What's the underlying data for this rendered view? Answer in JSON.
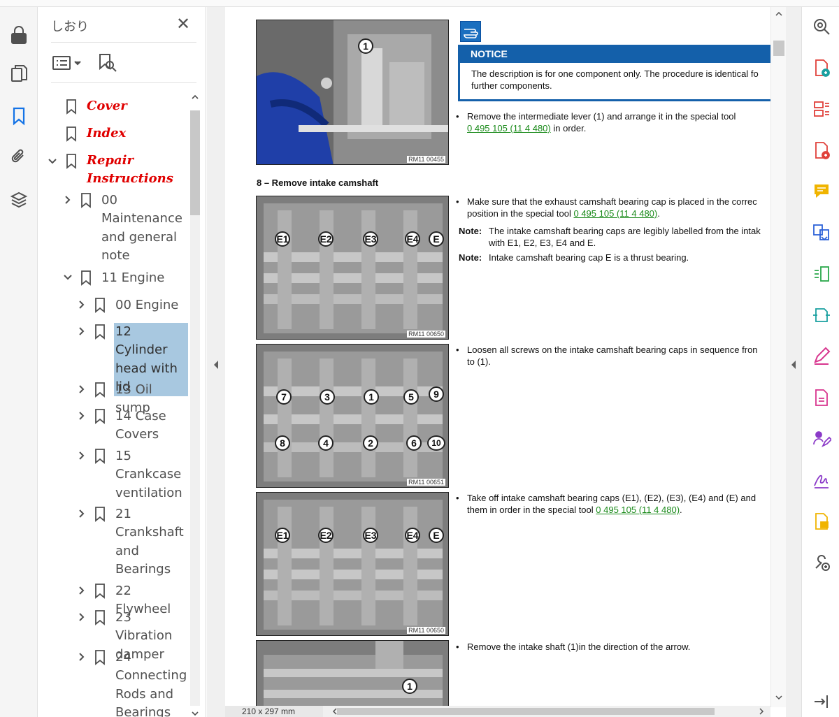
{
  "bookmarks_panel": {
    "title": "しおり",
    "close_symbol": "✕",
    "options_icon": "list-options-icon",
    "find_icon": "find-bookmark-icon",
    "items": [
      {
        "label": "Cover",
        "style": "red"
      },
      {
        "label": "Index",
        "style": "red"
      },
      {
        "label_lines": [
          "Repair",
          "Instructions"
        ],
        "style": "red"
      },
      {
        "label_lines": [
          "00",
          "Maintenance",
          "and general",
          "note"
        ]
      },
      {
        "label": "11 Engine"
      },
      {
        "label": "00 Engine"
      },
      {
        "label_lines": [
          "12 Cylinder",
          "head with",
          "lid"
        ],
        "selected": true
      },
      {
        "label": "13 Oil sump"
      },
      {
        "label_lines": [
          "14 Case",
          "Covers"
        ]
      },
      {
        "label_lines": [
          "15",
          "Crankcase",
          "ventilation"
        ]
      },
      {
        "label_lines": [
          "21",
          "Crankshaft",
          "and",
          "Bearings"
        ]
      },
      {
        "label": "22 Flywheel"
      },
      {
        "label_lines": [
          "23 Vibration",
          "damper"
        ]
      },
      {
        "label_lines": [
          "24",
          "Connecting",
          "Rods and",
          "Bearings"
        ]
      }
    ]
  },
  "document": {
    "notice_title": "NOTICE",
    "notice_line1": "The description is for one component only. The procedure is identical fo",
    "notice_line2": "further components.",
    "step1_line1": "Remove the intermediate lever (1) and arrange it in the special tool",
    "step1_link": "0 495 105 (11 4 480)",
    "step1_tail": " in order.",
    "section_heading": "8 – Remove intake camshaft",
    "step2_line1": "Make sure that the exhaust camshaft bearing cap is placed in the correc",
    "step2_line2_pre": "position in the special tool ",
    "step2_link": "0 495 105 (11 4 480)",
    "step2_tail": ".",
    "note_label": "Note:",
    "note1_line1": "The intake camshaft bearing caps are legibly labelled from the intak",
    "note1_line2": "with E1, E2, E3, E4 and E.",
    "note2": "Intake camshaft bearing cap E is a thrust bearing.",
    "step3_line1": "Loosen all screws on the intake camshaft bearing caps in sequence fron",
    "step3_line2": "to (1).",
    "step4_line1": "Take off intake camshaft bearing caps (E1), (E2), (E3), (E4) and (E) and",
    "step4_line2_pre": "them in order in the special tool ",
    "step4_link": "0 495 105 (11 4 480)",
    "step4_tail": ".",
    "step5_line1": "Remove the intake shaft (1)in the direction of the arrow.",
    "bullet": "•",
    "images": [
      {
        "code": "RM11 00455",
        "callouts": [
          "1"
        ]
      },
      {
        "code": "RM11 00650",
        "callouts": [
          "E1",
          "E2",
          "E3",
          "E4",
          "E"
        ]
      },
      {
        "code": "RM11 00651",
        "callouts": [
          "7",
          "3",
          "1",
          "5",
          "9",
          "8",
          "4",
          "2",
          "6",
          "10"
        ]
      },
      {
        "code": "RM11 00650",
        "callouts": [
          "E1",
          "E2",
          "E3",
          "E4",
          "E"
        ]
      },
      {
        "code": "",
        "callouts": [
          "1"
        ]
      }
    ]
  },
  "status": {
    "page_size": "210 x 297 mm"
  },
  "colors": {
    "accent": "#1473e6",
    "bookmark_red": "#e00000",
    "link_green": "#1a8a1a",
    "notice_blue": "#1460aa",
    "selection": "#a8c8e0"
  },
  "left_rail_icons": [
    "lock-icon",
    "pages-icon",
    "bookmark-icon",
    "attachment-icon",
    "layers-icon"
  ],
  "right_rail_icons": [
    "zoom-icon",
    "create-pdf-icon",
    "organize-pages-icon",
    "add-pdf-icon",
    "comment-icon",
    "export-pdf-icon",
    "compress-icon",
    "send-icon",
    "edit-icon",
    "document-icon",
    "request-signature-icon",
    "fill-sign-icon",
    "note-icon",
    "more-tools-icon",
    "collapse-icon"
  ]
}
